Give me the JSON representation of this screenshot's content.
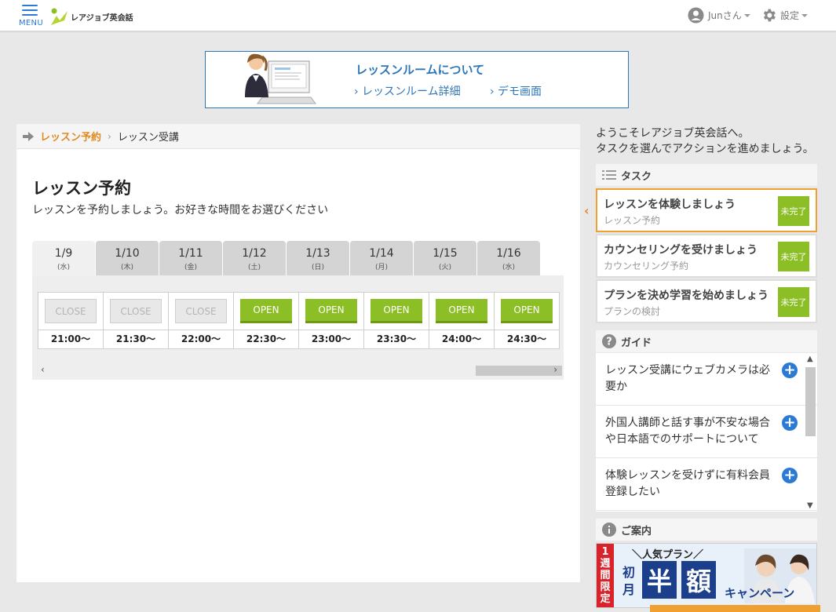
{
  "header": {
    "menu_label": "MENU",
    "logo_text": "レアジョブ英会話",
    "user_label": "Junさん",
    "settings_label": "設定"
  },
  "banner": {
    "title": "レッスンルームについて",
    "link1": "› レッスンルーム詳細",
    "link2": "› デモ画面"
  },
  "breadcrumb": {
    "item1": "レッスン予約",
    "separator": "›",
    "item2": "レッスン受講"
  },
  "page": {
    "title": "レッスン予約",
    "subtitle": "レッスンを予約しましょう。お好きな時間をお選びください"
  },
  "schedule": {
    "tabs": [
      {
        "date": "1/9",
        "weekday": "(水)"
      },
      {
        "date": "1/10",
        "weekday": "(木)"
      },
      {
        "date": "1/11",
        "weekday": "(金)"
      },
      {
        "date": "1/12",
        "weekday": "(土)"
      },
      {
        "date": "1/13",
        "weekday": "(日)"
      },
      {
        "date": "1/14",
        "weekday": "(月)"
      },
      {
        "date": "1/15",
        "weekday": "(火)"
      },
      {
        "date": "1/16",
        "weekday": "(水)"
      }
    ],
    "slots": [
      {
        "status": "CLOSE",
        "time": "21:00～"
      },
      {
        "status": "CLOSE",
        "time": "21:30～"
      },
      {
        "status": "CLOSE",
        "time": "22:00～"
      },
      {
        "status": "OPEN",
        "time": "22:30～"
      },
      {
        "status": "OPEN",
        "time": "23:00～"
      },
      {
        "status": "OPEN",
        "time": "23:30～"
      },
      {
        "status": "OPEN",
        "time": "24:00～"
      },
      {
        "status": "OPEN",
        "time": "24:30～"
      }
    ],
    "scroll_left": "‹",
    "scroll_right": "›"
  },
  "sidebar": {
    "welcome_line1": "ようこそレアジョブ英会話へ。",
    "welcome_line2": "タスクを選んでアクションを進めましょう。",
    "tasks_heading": "タスク",
    "tasks": [
      {
        "title": "レッスンを体験しましょう",
        "sub": "レッスン予約",
        "badge": "未完了"
      },
      {
        "title": "カウンセリングを受けましょう",
        "sub": "カウンセリング予約",
        "badge": "未完了"
      },
      {
        "title": "プランを決め学習を始めましょう",
        "sub": "プランの検討",
        "badge": "未完了"
      }
    ],
    "guide_heading": "ガイド",
    "guides": [
      {
        "text": "レッスン受講にウェブカメラは必要か"
      },
      {
        "text": "外国人講師と話す事が不安な場合や日本語でのサポートについて"
      },
      {
        "text": "体験レッスンを受けずに有料会員登録したい"
      }
    ],
    "info_heading": "ご案内",
    "promo": {
      "side": "1週間限定",
      "popular": "＼人気プラン／",
      "first": "初月",
      "k1": "半",
      "k2": "額",
      "campaign": "キャンペーン"
    }
  },
  "colors": {
    "accent_blue": "#2b7bd6",
    "open_green": "#8cbf26",
    "active_orange": "#f0a030"
  }
}
